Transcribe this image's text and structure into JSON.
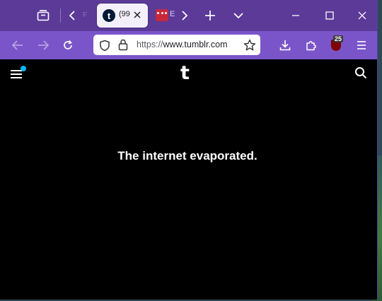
{
  "tabstrip": {
    "active_tab": {
      "favicon_letter": "t",
      "title": "(99"
    },
    "inactive_tab": {
      "title": "E"
    },
    "dim_label": "F"
  },
  "navbar": {
    "url_prefix": "https://",
    "url_host": "www.tumblr.com",
    "extension_badge": "25"
  },
  "page": {
    "logo_letter": "t",
    "message": "The internet evaporated."
  },
  "colors": {
    "tabstrip_bg": "#5b3a98",
    "navbar_bg": "#7a55c9",
    "page_bg": "#000000",
    "notification_dot": "#00b8ff"
  }
}
